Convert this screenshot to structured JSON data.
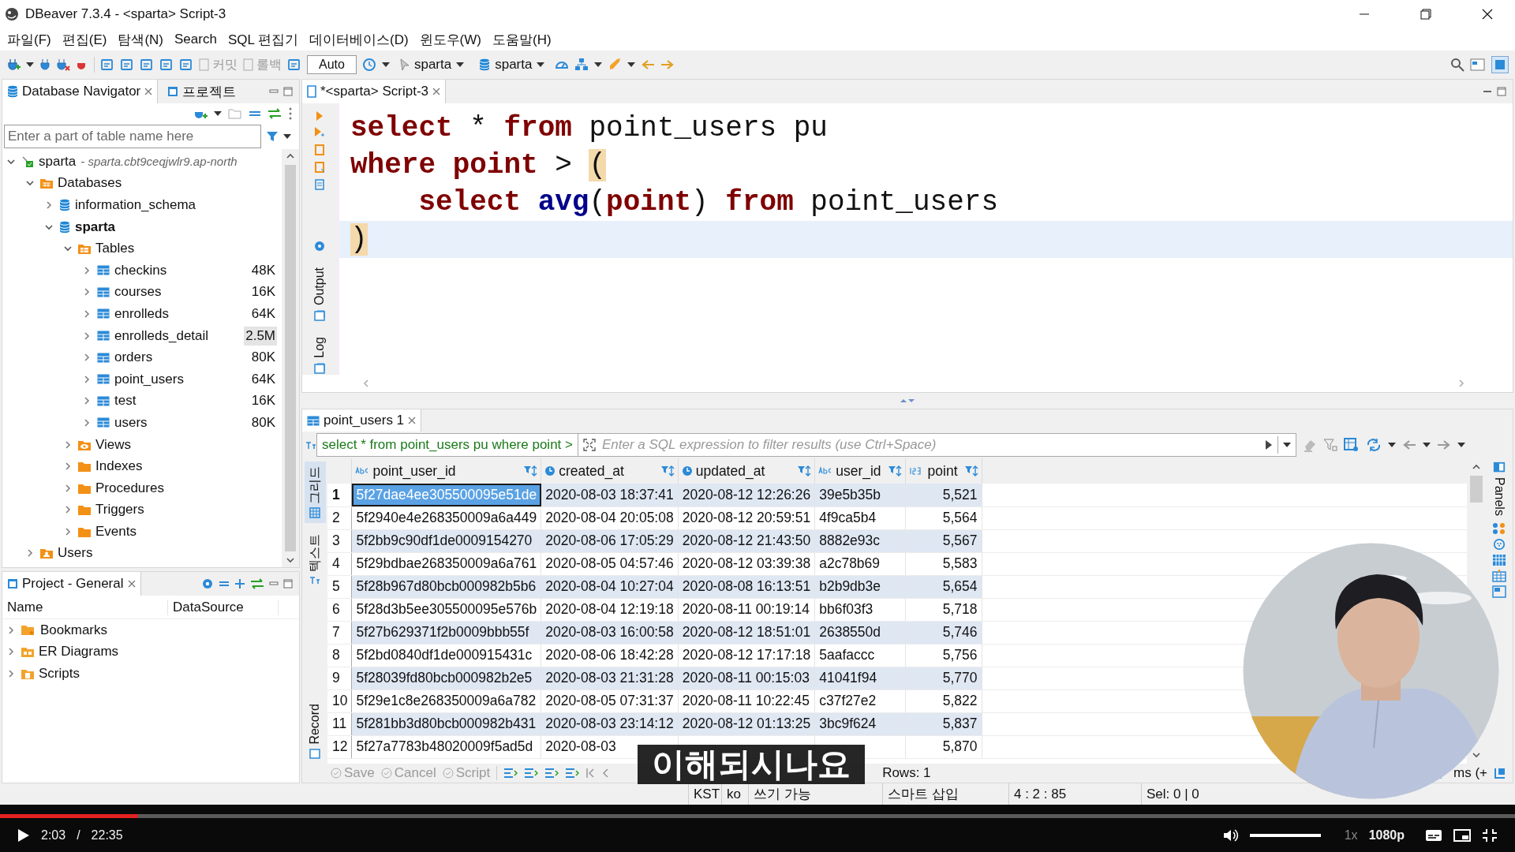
{
  "window": {
    "title": "DBeaver 7.3.4 - <sparta> Script-3"
  },
  "menu": [
    "파일(F)",
    "편집(E)",
    "탐색(N)",
    "Search",
    "SQL 편집기",
    "데이터베이스(D)",
    "윈도우(W)",
    "도움말(H)"
  ],
  "toolbar": [
    {
      "kind": "button",
      "label": "커밋",
      "disabled": true
    },
    {
      "kind": "button",
      "label": "롤백",
      "disabled": true
    },
    {
      "kind": "combo",
      "label": "Auto"
    },
    {
      "kind": "dropdown",
      "label": "sparta"
    },
    {
      "kind": "dropdown",
      "label": "sparta"
    }
  ],
  "navigator": {
    "tabs": [
      {
        "label": "Database Navigator",
        "selected": true
      },
      {
        "label": "프로젝트",
        "selected": false
      }
    ],
    "filter": {
      "placeholder": "Enter a part of table name here"
    },
    "tree": [
      {
        "kind": "connection",
        "label": "sparta",
        "detail": "- sparta.cbt9ceqjwlr9.ap-north",
        "expanded": true,
        "active": false,
        "children": [
          {
            "kind": "databases",
            "label": "Databases",
            "expanded": true,
            "active": false,
            "children": [
              {
                "kind": "database",
                "label": "information_schema",
                "expanded": false,
                "active": false
              },
              {
                "kind": "database",
                "label": "sparta",
                "expanded": true,
                "active": true,
                "children": [
                  {
                    "kind": "tables",
                    "label": "Tables",
                    "expanded": true,
                    "active": false,
                    "children": [
                      {
                        "kind": "table",
                        "label": "checkins",
                        "size": "48K",
                        "expanded": false,
                        "active": false,
                        "hovered": false
                      },
                      {
                        "kind": "table",
                        "label": "courses",
                        "size": "16K",
                        "expanded": false,
                        "active": false,
                        "hovered": false
                      },
                      {
                        "kind": "table",
                        "label": "enrolleds",
                        "size": "64K",
                        "expanded": false,
                        "active": false,
                        "hovered": false
                      },
                      {
                        "kind": "table",
                        "label": "enrolleds_detail",
                        "size": "2.5M",
                        "expanded": false,
                        "active": false,
                        "hovered": true
                      },
                      {
                        "kind": "table",
                        "label": "orders",
                        "size": "80K",
                        "expanded": false,
                        "active": false,
                        "hovered": false
                      },
                      {
                        "kind": "table",
                        "label": "point_users",
                        "size": "64K",
                        "expanded": false,
                        "active": false,
                        "hovered": false
                      },
                      {
                        "kind": "table",
                        "label": "test",
                        "size": "16K",
                        "expanded": false,
                        "active": false,
                        "hovered": false
                      },
                      {
                        "kind": "table",
                        "label": "users",
                        "size": "80K",
                        "expanded": false,
                        "active": false,
                        "hovered": false
                      }
                    ]
                  },
                  {
                    "kind": "views",
                    "label": "Views",
                    "expanded": false,
                    "active": false
                  },
                  {
                    "kind": "folder",
                    "label": "Indexes",
                    "expanded": false,
                    "active": false
                  },
                  {
                    "kind": "folder",
                    "label": "Procedures",
                    "expanded": false,
                    "active": false
                  },
                  {
                    "kind": "folder",
                    "label": "Triggers",
                    "expanded": false,
                    "active": false
                  },
                  {
                    "kind": "folder",
                    "label": "Events",
                    "expanded": false,
                    "active": false
                  }
                ]
              }
            ]
          },
          {
            "kind": "users",
            "label": "Users",
            "expanded": false,
            "active": false
          }
        ]
      }
    ]
  },
  "project": {
    "tab": "Project - General",
    "columns": [
      "Name",
      "DataSource"
    ],
    "items": [
      {
        "kind": "bookmarks",
        "label": "Bookmarks",
        "expanded": false
      },
      {
        "kind": "diagrams",
        "label": "ER Diagrams",
        "expanded": false
      },
      {
        "kind": "scripts",
        "label": "Scripts",
        "expanded": false
      }
    ]
  },
  "editor": {
    "tab": {
      "label": "*<sparta> Script-3",
      "selected": true
    },
    "side_tabs": [
      "Output",
      "Log"
    ],
    "lines": [
      {
        "current": false,
        "tokens": [
          {
            "kind": "keyword",
            "text": "select"
          },
          {
            "kind": "plain",
            "text": " * "
          },
          {
            "kind": "keyword",
            "text": "from"
          },
          {
            "kind": "plain",
            "text": " point_users pu"
          }
        ]
      },
      {
        "current": false,
        "tokens": [
          {
            "kind": "keyword",
            "text": "where"
          },
          {
            "kind": "keyword",
            "text": " point"
          },
          {
            "kind": "plain",
            "text": " > "
          },
          {
            "kind": "match",
            "text": "("
          }
        ]
      },
      {
        "current": false,
        "tokens": [
          {
            "kind": "keyword",
            "text": "    select"
          },
          {
            "kind": "function",
            "text": " avg"
          },
          {
            "kind": "plain",
            "text": "("
          },
          {
            "kind": "keyword",
            "text": "point"
          },
          {
            "kind": "plain",
            "text": ") "
          },
          {
            "kind": "keyword",
            "text": "from"
          },
          {
            "kind": "plain",
            "text": " point_users"
          }
        ]
      },
      {
        "current": true,
        "tokens": [
          {
            "kind": "match",
            "text": ")"
          }
        ]
      }
    ]
  },
  "results": {
    "tab": {
      "label": "point_users 1",
      "selected": true
    },
    "filter_query": "select * from point_users pu where point >",
    "filter": {
      "placeholder": "Enter a SQL expression to filter results (use Ctrl+Space)"
    },
    "side_tabs": [
      {
        "label": "그리드",
        "selected": true
      },
      {
        "label": "텍스트",
        "selected": false
      },
      {
        "label": "Record",
        "selected": false
      }
    ],
    "columns": [
      {
        "label": "point_user_id",
        "kind": "text"
      },
      {
        "label": "created_at",
        "kind": "datetime"
      },
      {
        "label": "updated_at",
        "kind": "datetime"
      },
      {
        "label": "user_id",
        "kind": "text"
      },
      {
        "label": "point",
        "kind": "number"
      }
    ],
    "rows": [
      {
        "num": "1",
        "selected": true,
        "cells": [
          "5f27dae4ee305500095e51de",
          "2020-08-03 18:37:41",
          "2020-08-12 12:26:26",
          "39e5b35b",
          "5,521"
        ]
      },
      {
        "num": "2",
        "selected": false,
        "cells": [
          "5f2940e4e268350009a6a449",
          "2020-08-04 20:05:08",
          "2020-08-12 20:59:51",
          "4f9ca5b4",
          "5,564"
        ]
      },
      {
        "num": "3",
        "selected": false,
        "cells": [
          "5f2bb9c90df1de0009154270",
          "2020-08-06 17:05:29",
          "2020-08-12 21:43:50",
          "8882e93c",
          "5,567"
        ]
      },
      {
        "num": "4",
        "selected": false,
        "cells": [
          "5f29bdbae268350009a6a761",
          "2020-08-05 04:57:46",
          "2020-08-12 03:39:38",
          "a2c78b69",
          "5,583"
        ]
      },
      {
        "num": "5",
        "selected": false,
        "cells": [
          "5f28b967d80bcb000982b5b6",
          "2020-08-04 10:27:04",
          "2020-08-08 16:13:51",
          "b2b9db3e",
          "5,654"
        ]
      },
      {
        "num": "6",
        "selected": false,
        "cells": [
          "5f28d3b5ee305500095e576b",
          "2020-08-04 12:19:18",
          "2020-08-11 00:19:14",
          "bb6f03f3",
          "5,718"
        ]
      },
      {
        "num": "7",
        "selected": false,
        "cells": [
          "5f27b629371f2b0009bbb55f",
          "2020-08-03 16:00:58",
          "2020-08-12 18:51:01",
          "2638550d",
          "5,746"
        ]
      },
      {
        "num": "8",
        "selected": false,
        "cells": [
          "5f2bd0840df1de000915431c",
          "2020-08-06 18:42:28",
          "2020-08-12 17:17:18",
          "5aafaccc",
          "5,756"
        ]
      },
      {
        "num": "9",
        "selected": false,
        "cells": [
          "5f28039fd80bcb000982b2e5",
          "2020-08-03 21:31:28",
          "2020-08-11 00:15:03",
          "41041f94",
          "5,770"
        ]
      },
      {
        "num": "10",
        "selected": false,
        "cells": [
          "5f29e1c8e268350009a6a782",
          "2020-08-05 07:31:37",
          "2020-08-11 10:22:45",
          "c37f27e2",
          "5,822"
        ]
      },
      {
        "num": "11",
        "selected": false,
        "cells": [
          "5f281bb3d80bcb000982b431",
          "2020-08-03 23:14:12",
          "2020-08-12 01:13:25",
          "3bc9f624",
          "5,837"
        ]
      },
      {
        "num": "12",
        "selected": false,
        "cells": [
          "5f27a7783b48020009f5ad5d",
          "2020-08-03",
          null,
          null,
          "5,870"
        ]
      }
    ],
    "actions": [
      {
        "label": "Save",
        "disabled": true
      },
      {
        "label": "Cancel",
        "disabled": true
      },
      {
        "label": "Script",
        "disabled": true
      }
    ],
    "row_count": "Rows: 1",
    "timing": "ms (+",
    "panels_label": "Panels"
  },
  "status_bar": [
    "KST",
    "ko",
    "쓰기 가능",
    "스마트 삽입",
    "4 : 2 : 85",
    "Sel: 0 | 0"
  ],
  "subtitle": "이해되시나요",
  "webcam": {
    "kind": "picture"
  },
  "player": {
    "progress": {
      "level": 0.091
    },
    "elapsed": "2:03",
    "separator": "/",
    "duration": "22:35",
    "volume": {
      "level": 1
    },
    "speed": "1x",
    "quality": "1080p"
  }
}
